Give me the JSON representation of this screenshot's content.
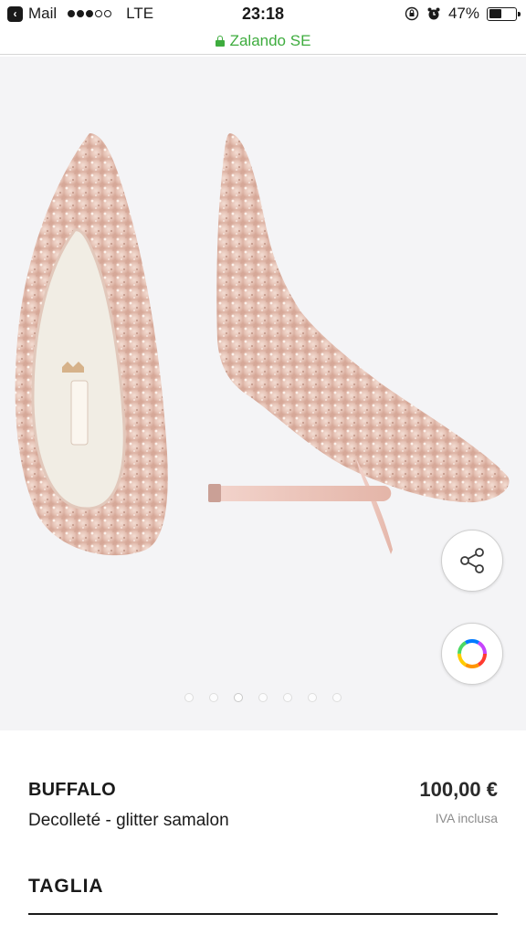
{
  "status_bar": {
    "back_app": "Mail",
    "network": "LTE",
    "time": "23:18",
    "battery_percent": "47%",
    "battery_level": 0.47,
    "signal_bars_filled": 3,
    "signal_bars_total": 5
  },
  "browser": {
    "url_domain": "Zalando SE",
    "secure_color": "#3eac3e"
  },
  "gallery": {
    "image_count": 7,
    "active_index": 2,
    "share_icon": "share-icon",
    "color_icon": "color-wheel-icon"
  },
  "product": {
    "brand": "BUFFALO",
    "name": "Decolleté - glitter samalon",
    "price": "100,00 €",
    "vat_note": "IVA inclusa"
  },
  "size_section": {
    "title": "TAGLIA"
  }
}
